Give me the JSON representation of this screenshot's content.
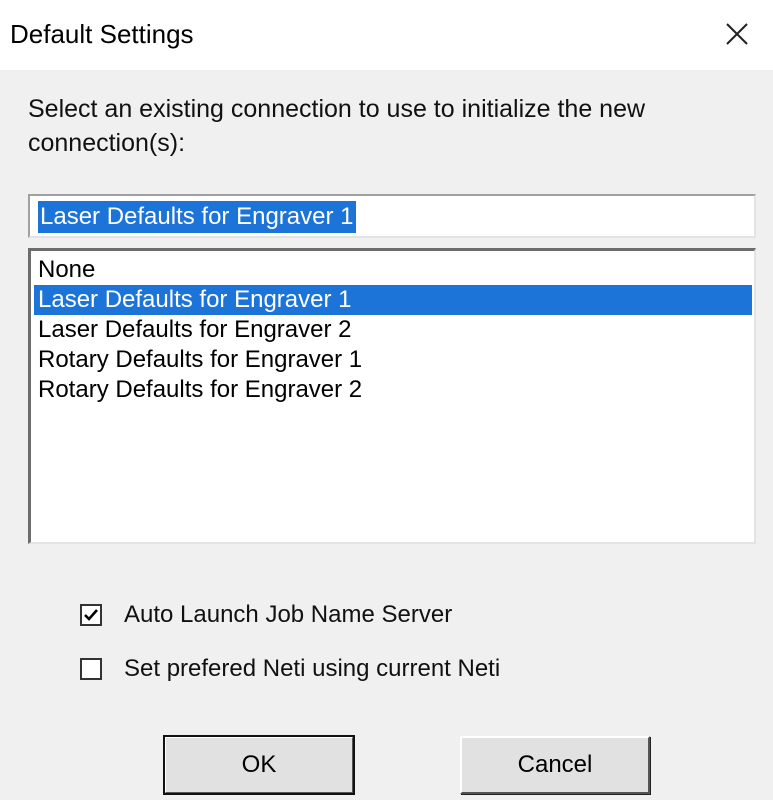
{
  "window": {
    "title": "Default Settings",
    "close_icon": "close-icon"
  },
  "prompt": "Select an existing connection to use to initialize the new connection(s):",
  "selected_field": {
    "value": "Laser Defaults for Engraver 1"
  },
  "list": {
    "items": [
      "None",
      "Laser Defaults for Engraver 1",
      "Laser Defaults for Engraver 2",
      "Rotary Defaults for Engraver 1",
      "Rotary Defaults for Engraver 2"
    ],
    "selected_index": 1
  },
  "options": {
    "auto_launch": {
      "label": "Auto Launch Job Name Server",
      "checked": true
    },
    "set_neti": {
      "label": "Set prefered Neti using current Neti",
      "checked": false
    }
  },
  "buttons": {
    "ok": "OK",
    "cancel": "Cancel"
  },
  "colors": {
    "selection": "#1c74d9",
    "dialog_bg": "#f0f0f0"
  }
}
